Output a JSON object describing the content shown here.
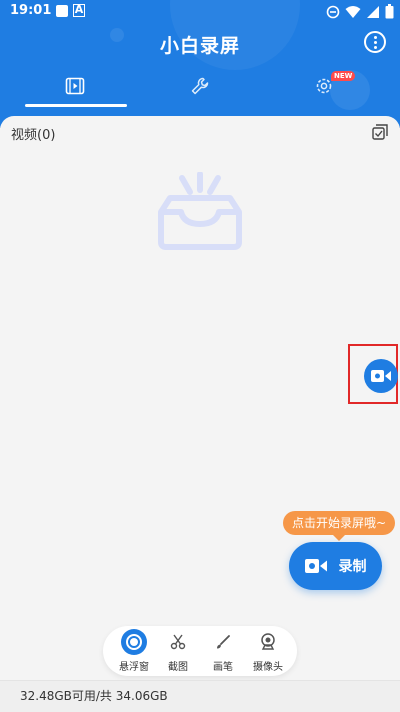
{
  "status_bar": {
    "time": "19:01",
    "notification_letter": "A"
  },
  "app": {
    "title": "小白录屏",
    "accent_color": "#1f7de2"
  },
  "tabs": [
    {
      "icon": "video-icon",
      "selected": true
    },
    {
      "icon": "wrench-icon",
      "selected": false
    },
    {
      "icon": "settings-gear-icon",
      "selected": false,
      "badge": "NEW"
    }
  ],
  "videos": {
    "count_label": "视频(0)"
  },
  "hint": {
    "text": "点击开始录屏哦~"
  },
  "record": {
    "label": "录制"
  },
  "toolbar": {
    "items": [
      {
        "label": "悬浮窗",
        "icon": "floating-window-icon",
        "active": true
      },
      {
        "label": "截图",
        "icon": "scissors-icon",
        "active": false
      },
      {
        "label": "画笔",
        "icon": "brush-icon",
        "active": false
      },
      {
        "label": "摄像头",
        "icon": "camera-icon",
        "active": false
      }
    ]
  },
  "storage": {
    "text": "32.48GB可用/共 34.06GB"
  }
}
